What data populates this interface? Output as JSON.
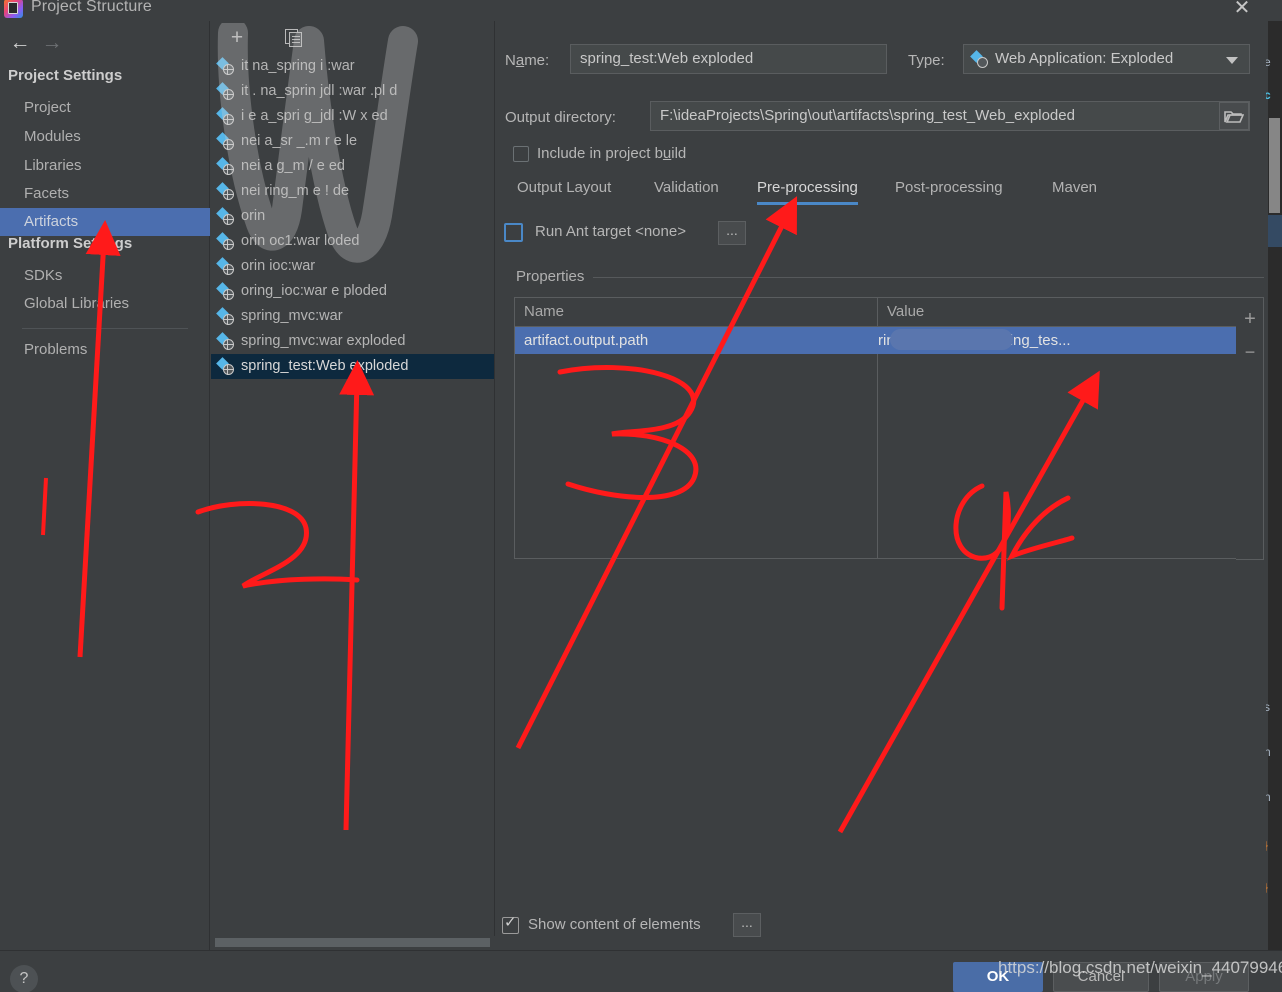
{
  "window": {
    "title": "Project Structure",
    "close_label": "✕",
    "app_icon": "intellij-idea-icon"
  },
  "nav": {
    "back_label": "←",
    "forward_label": "→"
  },
  "sidebar": {
    "sections": [
      {
        "header": "Project Settings",
        "items": [
          {
            "label": "Project",
            "selected": false
          },
          {
            "label": "Modules",
            "selected": false
          },
          {
            "label": "Libraries",
            "selected": false
          },
          {
            "label": "Facets",
            "selected": false
          },
          {
            "label": "Artifacts",
            "selected": true
          }
        ]
      },
      {
        "header": "Platform Settings",
        "items": [
          {
            "label": "SDKs",
            "selected": false
          },
          {
            "label": "Global Libraries",
            "selected": false
          }
        ]
      }
    ],
    "problems_label": "Problems"
  },
  "artifacts_panel": {
    "toolbar": {
      "add_label": "+",
      "copy_label": "copy-icon"
    },
    "items": [
      {
        "label": "it      na_spring  i      :war",
        "selected": false,
        "obscured": true
      },
      {
        "label": "it   .  na_sprin  jdl  :war   .pl        d",
        "selected": false,
        "obscured": true
      },
      {
        "label": "i   e   a_spri  g_jdl  :W      x       ed",
        "selected": false,
        "obscured": true
      },
      {
        "label": "nei   a_sr     _.m  r        e        le",
        "selected": false,
        "obscured": true
      },
      {
        "label": "nei   a       g_m    /     e      ed",
        "selected": false,
        "obscured": true
      },
      {
        "label": "nei        ring_m     e   !        de",
        "selected": false,
        "obscured": true
      },
      {
        "label": "orin",
        "selected": false,
        "obscured": true
      },
      {
        "label": "orin    oc1:war      loded",
        "selected": false,
        "obscured": true
      },
      {
        "label": "orin    ioc:war",
        "selected": false,
        "obscured": true
      },
      {
        "label": "oring_ioc:war e  ploded",
        "selected": false,
        "obscured": true
      },
      {
        "label": "spring_mvc:war",
        "selected": false,
        "obscured": false
      },
      {
        "label": "spring_mvc:war exploded",
        "selected": false,
        "obscured": false
      },
      {
        "label": "spring_test:Web exploded",
        "selected": true,
        "obscured": false
      }
    ]
  },
  "main": {
    "name_label": "Name:",
    "name_value": "spring_test:Web exploded",
    "type_label": "Type:",
    "type_value": "Web Application: Exploded",
    "type_icon": "web-artifact-icon",
    "output_dir_label": "Output directory:",
    "output_dir_value": "F:\\ideaProjects\\Spring\\out\\artifacts\\spring_test_Web_exploded",
    "browse_icon": "folder-icon",
    "include_in_build_label": "Include in project build",
    "include_in_build_checked": false,
    "tabs": [
      {
        "label": "Output Layout",
        "active": false
      },
      {
        "label": "Validation",
        "active": false
      },
      {
        "label": "Pre-processing",
        "active": true
      },
      {
        "label": "Post-processing",
        "active": false
      },
      {
        "label": "Maven",
        "active": false
      }
    ],
    "run_ant_label": "Run Ant target <none>",
    "run_ant_checked": false,
    "run_ant_browse": "...",
    "properties_group_label": "Properties",
    "table": {
      "columns": [
        "Name",
        "Value"
      ],
      "rows": [
        {
          "name": "artifact.output.path",
          "value": "ring/out/artifacts/spring_tes...",
          "selected": true,
          "value_partially_redacted": true
        }
      ],
      "add_label": "+",
      "remove_label": "−"
    },
    "show_content_label": "Show content of elements",
    "show_content_checked": true,
    "show_content_browse": "..."
  },
  "bottom": {
    "help_label": "?",
    "ok_label": "OK",
    "cancel_label": "Cancel",
    "apply_label": "Apply"
  },
  "watermark": {
    "url": "https://blog.csdn.net/weixin_44079946",
    "scribble": "W"
  },
  "colors": {
    "dialog_bg": "#3c3f41",
    "selection_blue": "#4b6eaf",
    "list_selection": "#0d293e",
    "accent_tab": "#4a88c7",
    "annotation_red": "#ff1a1a",
    "field_bg": "#45494a"
  }
}
